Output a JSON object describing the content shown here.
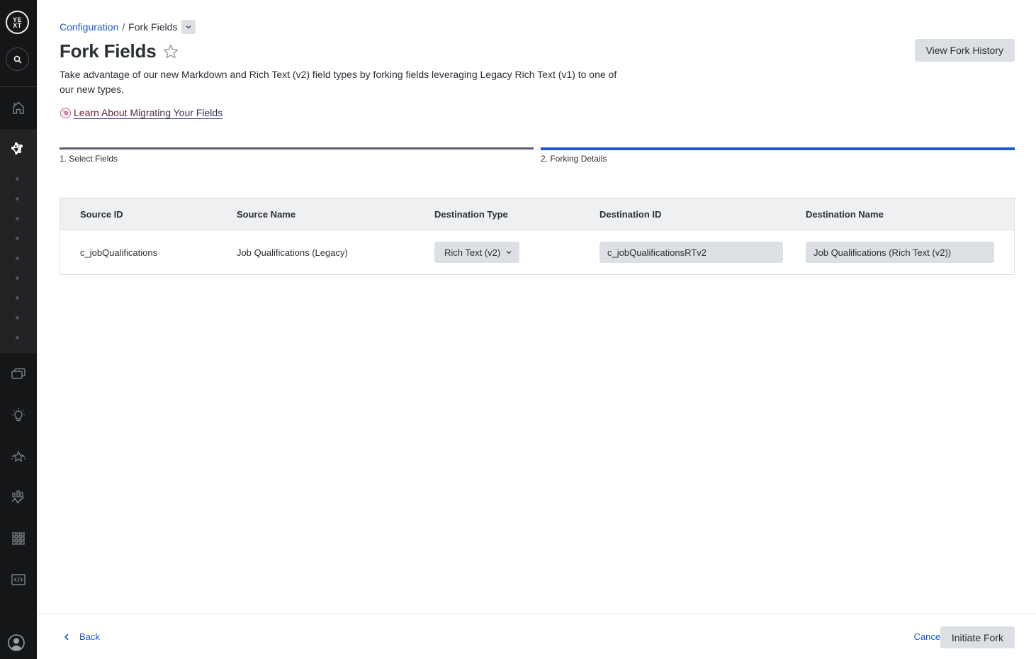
{
  "sidebar": {
    "logo_text_top": "YE",
    "logo_text_bottom": "XT",
    "items": [
      {
        "name": "search",
        "icon": "search-icon"
      },
      {
        "name": "home",
        "icon": "home-icon"
      },
      {
        "name": "knowledge-graph",
        "icon": "knowledge-graph-icon",
        "active": true
      },
      {
        "name": "pages",
        "icon": "pages-icon"
      },
      {
        "name": "search-experiences",
        "icon": "lightbulb-icon"
      },
      {
        "name": "reviews",
        "icon": "stars-icon"
      },
      {
        "name": "analytics",
        "icon": "analytics-icon"
      },
      {
        "name": "apps",
        "icon": "apps-grid-icon"
      },
      {
        "name": "developer",
        "icon": "code-icon"
      },
      {
        "name": "account",
        "icon": "user-profile-icon"
      }
    ]
  },
  "breadcrumb": {
    "parent": "Configuration",
    "separator": "/",
    "current": "Fork Fields"
  },
  "header": {
    "title": "Fork Fields",
    "history_button": "View Fork History",
    "description": "Take advantage of our new Markdown and Rich Text (v2) field types by forking fields leveraging Legacy Rich Text (v1) to one of our new types.",
    "learn_link": "Learn About Migrating Your Fields"
  },
  "stepper": {
    "steps": [
      {
        "label": "1. Select Fields",
        "state": "completed"
      },
      {
        "label": "2. Forking Details",
        "state": "active"
      }
    ],
    "active_color": "#1a58d6"
  },
  "table": {
    "columns": [
      "Source ID",
      "Source Name",
      "Destination Type",
      "Destination ID",
      "Destination Name"
    ],
    "rows": [
      {
        "source_id": "c_jobQualifications",
        "source_name": "Job Qualifications (Legacy)",
        "destination_type": "Rich Text (v2)",
        "destination_id": "c_jobQualificationsRTv2",
        "destination_name": "Job Qualifications (Rich Text (v2))"
      }
    ]
  },
  "footer": {
    "back_label": "Back",
    "cancel_label": "Cancel",
    "initiate_label": "Initiate Fork"
  }
}
